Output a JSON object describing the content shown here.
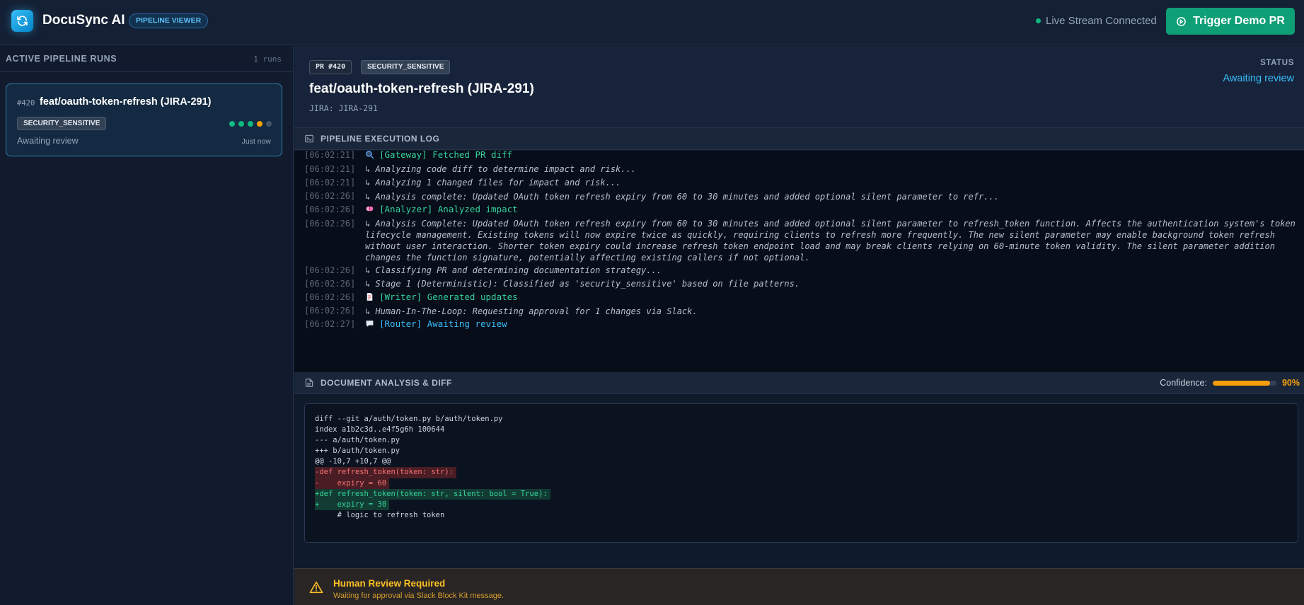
{
  "header": {
    "app_title": "DocuSync AI",
    "badge": "PIPELINE VIEWER",
    "live_status": "Live Stream Connected",
    "trigger_button": "Trigger Demo PR"
  },
  "sidebar": {
    "title": "ACTIVE PIPELINE RUNS",
    "count": "1 runs",
    "runs": [
      {
        "number": "#420",
        "title": "feat/oauth-token-refresh (JIRA-291)",
        "tag": "SECURITY_SENSITIVE",
        "status": "Awaiting review",
        "time": "Just now",
        "stage_colors": [
          "#10b981",
          "#10b981",
          "#10b981",
          "#f59e0b",
          "#475569"
        ]
      }
    ]
  },
  "pr": {
    "number": "PR #420",
    "tag": "SECURITY_SENSITIVE",
    "title": "feat/oauth-token-refresh (JIRA-291)",
    "jira": "JIRA: JIRA-291",
    "status_label": "STATUS",
    "status_value": "Awaiting review"
  },
  "log": {
    "title": "PIPELINE EXECUTION LOG",
    "entries": [
      {
        "time": "[06:02:21]",
        "text": "[Gateway] Fetched PR diff",
        "kind": "event",
        "icon": "magnifier-icon"
      },
      {
        "time": "[06:02:21]",
        "text": "↳ Analyzing code diff to determine impact and risk...",
        "kind": "sub"
      },
      {
        "time": "[06:02:21]",
        "text": "↳ Analyzing 1 changed files for impact and risk...",
        "kind": "sub"
      },
      {
        "time": "[06:02:26]",
        "text": "↳ Analysis complete: Updated OAuth token refresh expiry from 60 to 30 minutes and added optional silent parameter to refr...",
        "kind": "sub"
      },
      {
        "time": "[06:02:26]",
        "text": "[Analyzer] Analyzed impact",
        "kind": "event",
        "icon": "brain-icon"
      },
      {
        "time": "[06:02:26]",
        "text": "↳ Analysis Complete: Updated OAuth token refresh expiry from 60 to 30 minutes and added optional silent parameter to refresh_token function. Affects the authentication system's token lifecycle management. Existing tokens will now expire twice as quickly, requiring clients to refresh more frequently. The new silent parameter may enable background token refresh without user interaction. Shorter token expiry could increase refresh token endpoint load and may break clients relying on 60-minute token validity. The silent parameter addition changes the function signature, potentially affecting existing callers if not optional.",
        "kind": "sub"
      },
      {
        "time": "[06:02:26]",
        "text": "↳ Classifying PR and determining documentation strategy...",
        "kind": "sub"
      },
      {
        "time": "[06:02:26]",
        "text": "↳ Stage 1 (Deterministic): Classified as 'security_sensitive' based on file patterns.",
        "kind": "sub"
      },
      {
        "time": "[06:02:26]",
        "text": "[Writer] Generated updates",
        "kind": "event",
        "icon": "document-icon"
      },
      {
        "time": "[06:02:26]",
        "text": "↳ Human-In-The-Loop: Requesting approval for 1 changes via Slack.",
        "kind": "sub"
      },
      {
        "time": "[06:02:27]",
        "text": "[Router] Awaiting review",
        "kind": "event-blue",
        "icon": "speech-bubble-icon"
      }
    ]
  },
  "analysis": {
    "title": "DOCUMENT ANALYSIS & DIFF",
    "confidence_label": "Confidence:",
    "confidence_value": "90%",
    "confidence": 0.9,
    "diff": [
      {
        "text": "diff --git a/auth/token.py b/auth/token.py",
        "type": "meta"
      },
      {
        "text": "index a1b2c3d..e4f5g6h 100644",
        "type": "meta"
      },
      {
        "text": "--- a/auth/token.py",
        "type": "meta"
      },
      {
        "text": "+++ b/auth/token.py",
        "type": "meta"
      },
      {
        "text": "@@ -10,7 +10,7 @@",
        "type": "meta"
      },
      {
        "text": "-def refresh_token(token: str):",
        "type": "del"
      },
      {
        "text": "-    expiry = 60",
        "type": "del"
      },
      {
        "text": "+def refresh_token(token: str, silent: bool = True):",
        "type": "add"
      },
      {
        "text": "+    expiry = 30",
        "type": "add"
      },
      {
        "text": "     # logic to refresh token",
        "type": "ctx"
      }
    ]
  },
  "review": {
    "title": "Human Review Required",
    "subtitle": "Waiting for approval via Slack Block Kit message."
  }
}
